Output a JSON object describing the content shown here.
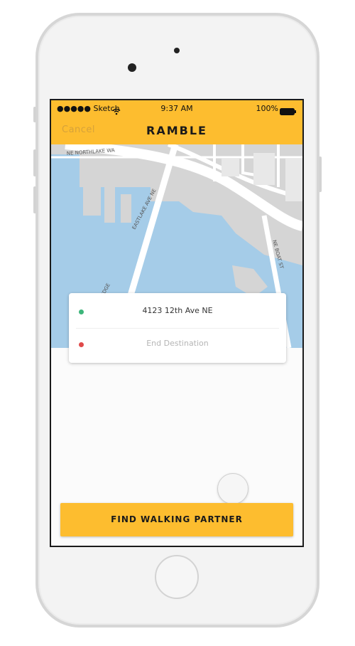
{
  "status_bar": {
    "carrier": "●●●●● Sketch",
    "time": "9:37 AM",
    "battery": "100%"
  },
  "header": {
    "cancel_label": "Cancel",
    "title": "RAMBLE"
  },
  "map": {
    "street_labels": [
      "NE NORTHLAKE WA",
      "EASTLAKE AVE NE",
      "NE BOAT ST",
      "IDGE"
    ],
    "colors": {
      "water": "#a5cce8",
      "land": "#d5d5d5",
      "roads": "#ffffff"
    }
  },
  "route_card": {
    "start": {
      "value": "4123 12th Ave NE",
      "dot_color": "#3db57a"
    },
    "end": {
      "placeholder": "End Destination",
      "dot_color": "#e04a4a"
    }
  },
  "cta": {
    "label": "FIND WALKING PARTNER"
  },
  "colors": {
    "accent": "#fdbd2f"
  }
}
